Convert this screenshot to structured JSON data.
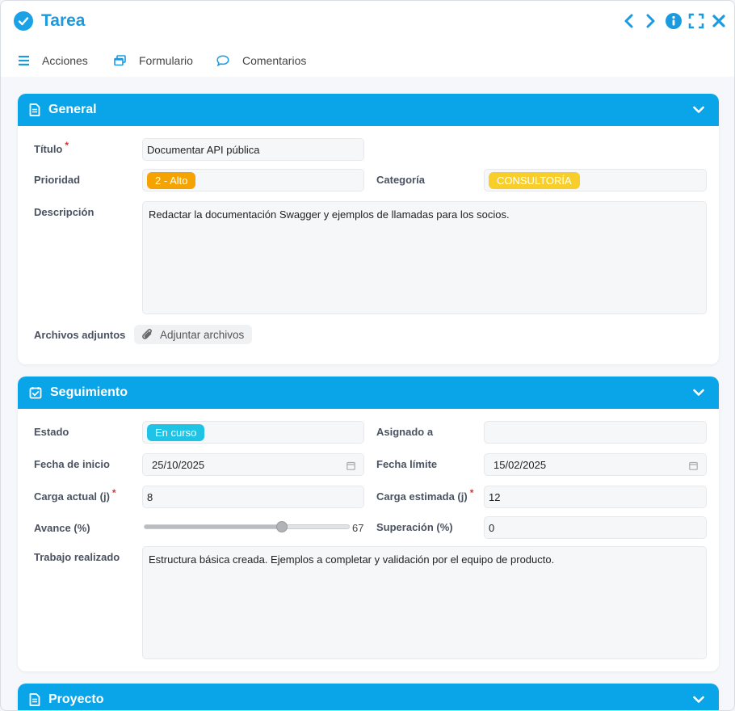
{
  "window": {
    "title": "Tarea"
  },
  "toolbar": {
    "actions": "Acciones",
    "form": "Formulario",
    "comments": "Comentarios"
  },
  "general": {
    "header": "General",
    "title_label": "Título",
    "title_value": "Documentar API pública",
    "priority_label": "Prioridad",
    "priority_value": "2 - Alto",
    "priority_color": "#f5a300",
    "category_label": "Categoría",
    "category_value": "CONSULTORÍA",
    "category_color": "#f8cf2a",
    "description_label": "Descripción",
    "description_value": "Redactar la documentación Swagger y ejemplos de llamadas para los socios.",
    "attachments_label": "Archivos adjuntos",
    "attach_button": "Adjuntar archivos"
  },
  "tracking": {
    "header": "Seguimiento",
    "state_label": "Estado",
    "state_value": "En curso",
    "state_color": "#1ec3e6",
    "assigned_label": "Asignado a",
    "assigned_value": "",
    "start_label": "Fecha de inicio",
    "start_value": "25/10/2025",
    "due_label": "Fecha límite",
    "due_value": "15/02/2025",
    "load_label": "Carga actual (j)",
    "load_value": "8",
    "est_label": "Carga estimada (j)",
    "est_value": "12",
    "progress_label": "Avance (%)",
    "progress_value": 67,
    "progress_text": "67",
    "overrun_label": "Superación (%)",
    "overrun_value": "0",
    "work_label": "Trabajo realizado",
    "work_value": "Estructura básica creada. Ejemplos a completar y validación por el equipo de producto."
  },
  "project": {
    "header": "Proyecto"
  },
  "colors": {
    "accent": "#0aa5e8",
    "title": "#1a9be0"
  }
}
